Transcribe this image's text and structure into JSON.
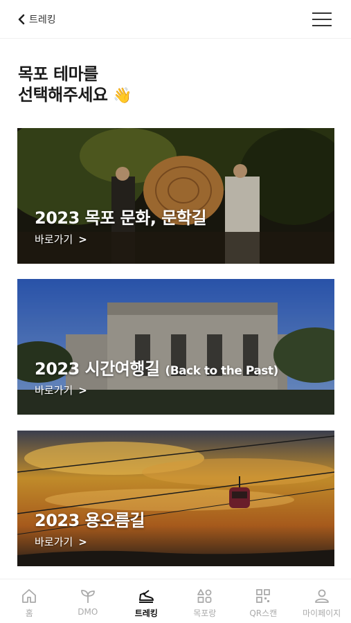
{
  "header": {
    "back_label": "트레킹"
  },
  "title": {
    "line1": "목포 테마를",
    "line2": "선택해주세요",
    "emoji": "👋"
  },
  "cards": [
    {
      "title": "2023 목포 문화, 문학길",
      "subtitle": "",
      "link": "바로가기"
    },
    {
      "title": "2023 시간여행길",
      "subtitle": "(Back to the Past)",
      "link": "바로가기"
    },
    {
      "title": "2023 용오름길",
      "subtitle": "",
      "link": "바로가기"
    }
  ],
  "bottom_nav": [
    {
      "label": "홈",
      "icon": "home-icon",
      "active": false
    },
    {
      "label": "DMO",
      "icon": "sprout-icon",
      "active": false
    },
    {
      "label": "트레킹",
      "icon": "shoe-icon",
      "active": true
    },
    {
      "label": "목포랑",
      "icon": "shapes-icon",
      "active": false
    },
    {
      "label": "QR스캔",
      "icon": "qr-icon",
      "active": false
    },
    {
      "label": "마이페이지",
      "icon": "person-icon",
      "active": false
    }
  ]
}
